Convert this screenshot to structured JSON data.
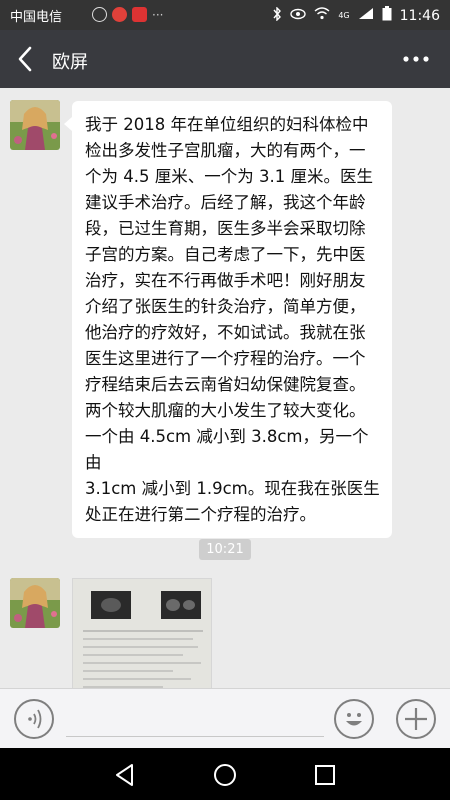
{
  "status_bar": {
    "carrier": "中国电信",
    "time": "11:46",
    "network_badge": "4G",
    "icons": [
      "k-icon",
      "record-icon",
      "app-icon",
      "more-dots-icon",
      "bluetooth-icon",
      "eye-icon",
      "wifi-icon",
      "signal-icon",
      "battery-icon"
    ]
  },
  "nav": {
    "title": "欧屏",
    "icons": [
      "back-arrow-icon",
      "more-icon"
    ]
  },
  "chat": {
    "messages": [
      {
        "type": "text",
        "lines": [
          "我于 2018 年在单位组织的妇科体检中",
          "检出多发性子宫肌瘤，大的有两个，一",
          "个为 4.5 厘米、一个为 3.1 厘米。医生",
          "建议手术治疗。后经了解，我这个年龄",
          "段，已过生育期，医生多半会采取切除",
          "子宫的方案。自己考虑了一下，先中医",
          "治疗，实在不行再做手术吧！刚好朋友",
          "介绍了张医生的针灸治疗，简单方便，",
          "他治疗的疗效好，不如试试。我就在张",
          "医生这里进行了一个疗程的治疗。一个",
          "疗程结束后去云南省妇幼保健院复查。",
          "两个较大肌瘤的大小发生了较大变化。",
          "一个由 4.5cm 减小到 3.8cm，另一个由",
          "3.1cm 减小到 1.9cm。现在我在张医生",
          "处正在进行第二个疗程的治疗。"
        ]
      },
      {
        "type": "timestamp",
        "text": "10:21"
      },
      {
        "type": "image",
        "description_icon": "medical-report-image"
      }
    ]
  },
  "input_bar": {
    "placeholder": "",
    "icons": [
      "voice-icon",
      "emoji-icon",
      "plus-icon"
    ]
  },
  "system_nav": {
    "icons": [
      "triangle-back-icon",
      "circle-home-icon",
      "square-recent-icon"
    ]
  },
  "colors": {
    "status_bg": "#343434",
    "nav_bg": "#393a3f",
    "chat_bg": "#ebebeb",
    "bubble_bg": "#ffffff",
    "input_bg": "#f4f4f6"
  }
}
